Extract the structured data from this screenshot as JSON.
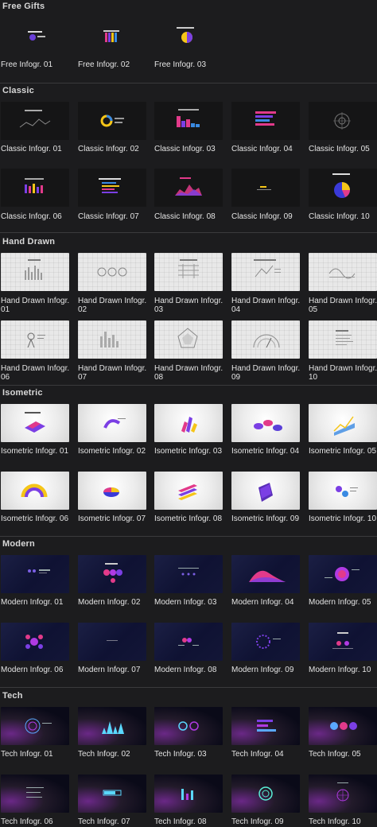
{
  "sections": [
    {
      "title": "Free Gifts",
      "items": [
        "Free Infogr. 01",
        "Free Infogr. 02",
        "Free Infogr. 03"
      ]
    },
    {
      "title": "Classic",
      "items": [
        "Classic Infogr. 01",
        "Classic Infogr. 02",
        "Classic Infogr. 03",
        "Classic Infogr. 04",
        "Classic Infogr. 05",
        "Classic Infogr. 06",
        "Classic Infogr. 07",
        "Classic Infogr. 08",
        "Classic Infogr. 09",
        "Classic Infogr. 10"
      ]
    },
    {
      "title": "Hand Drawn",
      "items": [
        "Hand Drawn Infogr. 01",
        "Hand Drawn Infogr. 02",
        "Hand Drawn Infogr. 03",
        "Hand Drawn Infogr. 04",
        "Hand Drawn Infogr. 05",
        "Hand Drawn Infogr. 06",
        "Hand Drawn Infogr. 07",
        "Hand Drawn Infogr. 08",
        "Hand Drawn Infogr. 09",
        "Hand Drawn Infogr. 10"
      ]
    },
    {
      "title": "Isometric",
      "items": [
        "Isometric Infogr. 01",
        "Isometric Infogr. 02",
        "Isometric Infogr. 03",
        "Isometric Infogr. 04",
        "Isometric Infogr. 05",
        "Isometric Infogr. 06",
        "Isometric Infogr. 07",
        "Isometric Infogr. 08",
        "Isometric Infogr. 09",
        "Isometric Infogr. 10"
      ]
    },
    {
      "title": "Modern",
      "items": [
        "Modern Infogr. 01",
        "Modern Infogr. 02",
        "Modern Infogr. 03",
        "Modern Infogr. 04",
        "Modern Infogr. 05",
        "Modern Infogr. 06",
        "Modern Infogr. 07",
        "Modern Infogr. 08",
        "Modern Infogr. 09",
        "Modern Infogr. 10"
      ]
    },
    {
      "title": "Tech",
      "items": [
        "Tech Infogr. 01",
        "Tech Infogr. 02",
        "Tech Infogr. 03",
        "Tech Infogr. 04",
        "Tech Infogr. 05",
        "Tech Infogr. 06",
        "Tech Infogr. 07",
        "Tech Infogr. 08",
        "Tech Infogr. 09",
        "Tech Infogr. 10"
      ]
    }
  ],
  "colors": {
    "background": "#1c1c1e",
    "divider": "#3a3a3c",
    "accent_purple": "#7b3fe4",
    "accent_pink": "#e23a8a",
    "accent_yellow": "#f5c518"
  }
}
